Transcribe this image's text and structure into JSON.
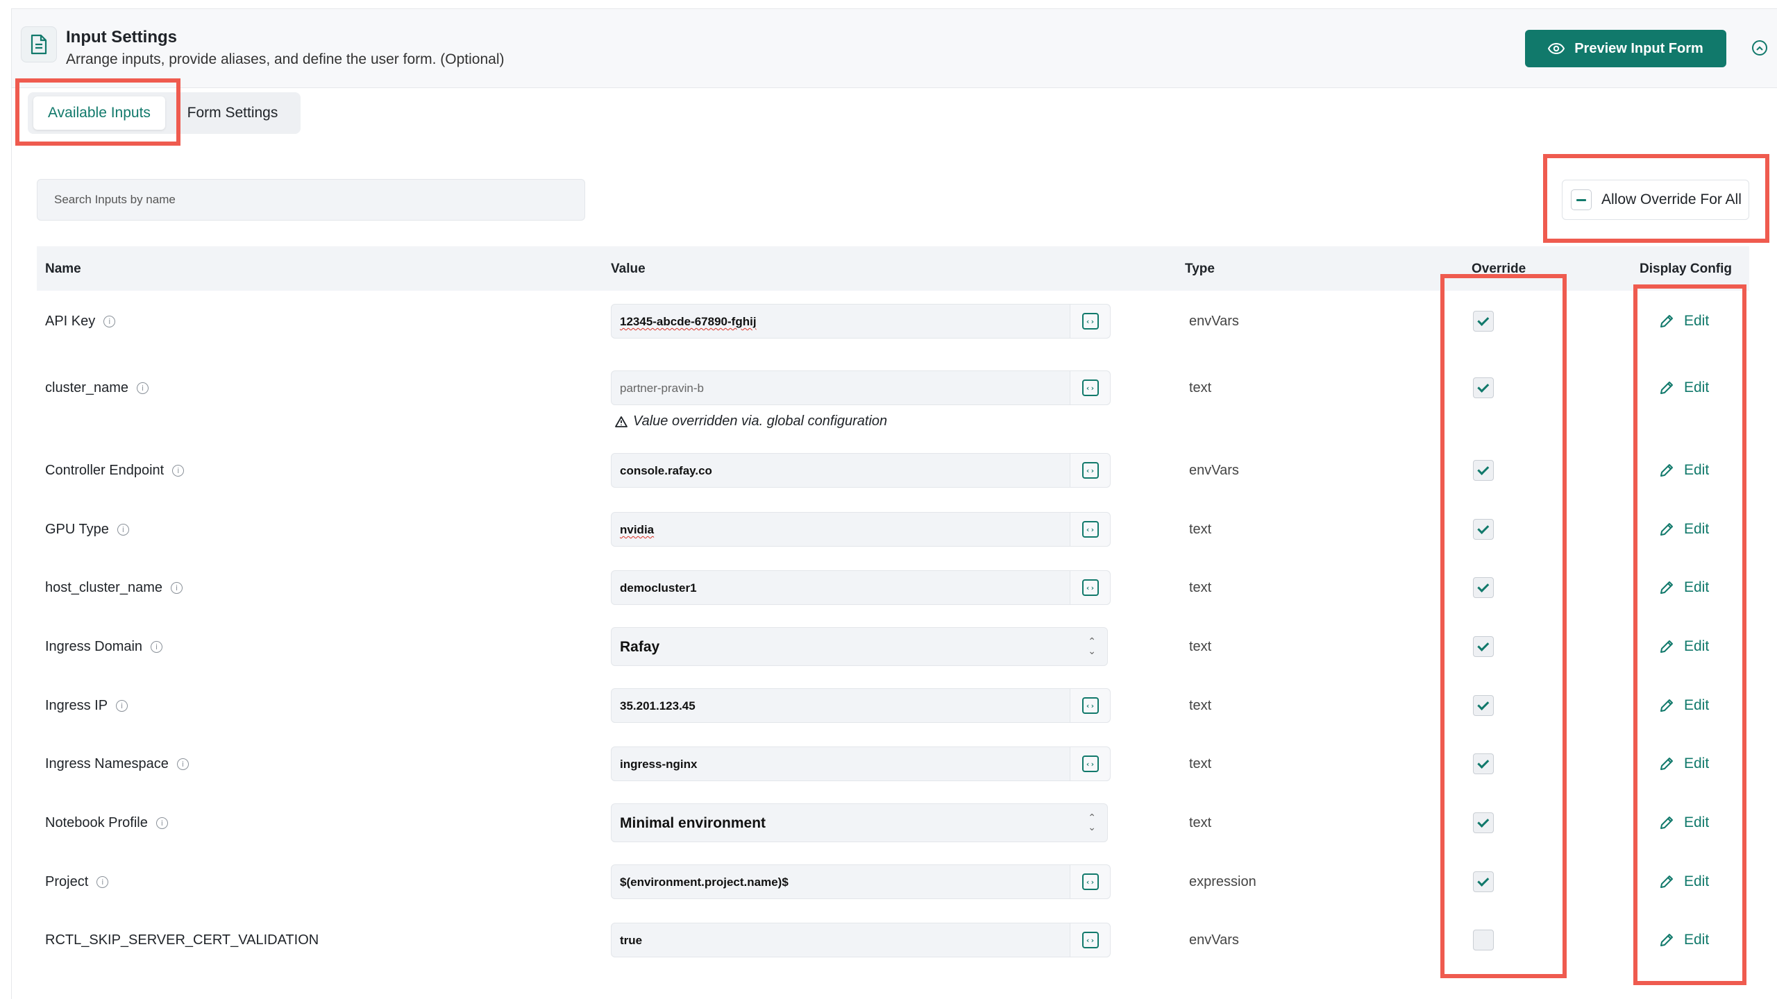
{
  "header": {
    "title": "Input Settings",
    "subtitle": "Arrange inputs, provide aliases, and define the user form. (Optional)",
    "preview_label": "Preview Input Form",
    "doc_icon": "document-icon",
    "collapse_icon": "chevron-up-circle-icon"
  },
  "tabs": [
    {
      "label": "Available Inputs",
      "active": true
    },
    {
      "label": "Form Settings",
      "active": false
    }
  ],
  "search": {
    "placeholder": "Search Inputs by name",
    "value": ""
  },
  "override_all": {
    "label": "Allow Override For All",
    "state": "indeterminate"
  },
  "table": {
    "columns": {
      "name": "Name",
      "value": "Value",
      "type": "Type",
      "override": "Override",
      "display": "Display Config"
    },
    "edit_label": "Edit",
    "rows": [
      {
        "name": "API Key",
        "info": true,
        "value": "12345-abcde-67890-fghij",
        "control": "input",
        "type": "envVars",
        "override": true
      },
      {
        "name": "cluster_name",
        "info": true,
        "value": "partner-pravin-b",
        "control": "input",
        "type": "text",
        "override": true,
        "warning": "Value overridden via. global configuration"
      },
      {
        "name": "Controller Endpoint",
        "info": true,
        "value": "console.rafay.co",
        "control": "input",
        "type": "envVars",
        "override": true
      },
      {
        "name": "GPU Type",
        "info": true,
        "value": "nvidia",
        "control": "input",
        "type": "text",
        "override": true
      },
      {
        "name": "host_cluster_name",
        "info": true,
        "value": "democluster1",
        "control": "input",
        "type": "text",
        "override": true
      },
      {
        "name": "Ingress Domain",
        "info": true,
        "value": "Rafay",
        "control": "select",
        "type": "text",
        "override": true
      },
      {
        "name": "Ingress IP",
        "info": true,
        "value": "35.201.123.45",
        "control": "input",
        "type": "text",
        "override": true
      },
      {
        "name": "Ingress Namespace",
        "info": true,
        "value": "ingress-nginx",
        "control": "input",
        "type": "text",
        "override": true
      },
      {
        "name": "Notebook Profile",
        "info": true,
        "value": "Minimal environment",
        "control": "select",
        "type": "text",
        "override": true
      },
      {
        "name": "Project",
        "info": true,
        "value": "$(environment.project.name)$",
        "control": "input",
        "type": "expression",
        "override": true
      },
      {
        "name": "RCTL_SKIP_SERVER_CERT_VALIDATION",
        "info": false,
        "value": "true",
        "control": "input",
        "type": "envVars",
        "override": false
      }
    ]
  },
  "colors": {
    "accent": "#11796b",
    "highlight": "#ef5b4f"
  }
}
